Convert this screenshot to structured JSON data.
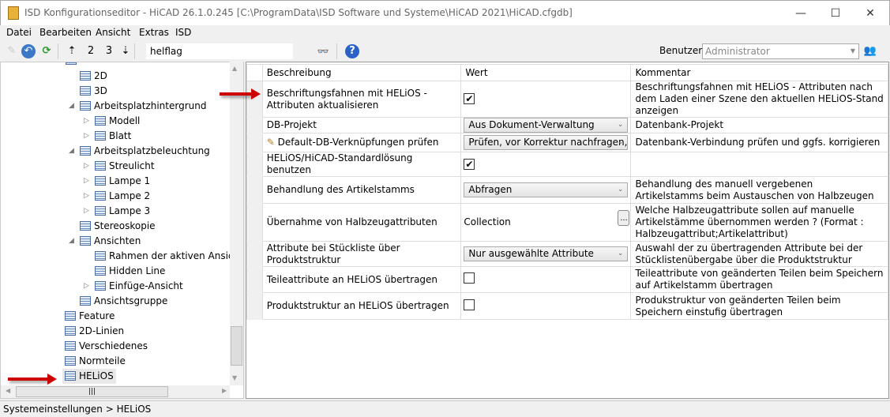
{
  "window": {
    "title": "ISD Konfigurationseditor  - HiCAD 26.1.0.245 [C:\\ProgramData\\ISD Software und Systeme\\HiCAD 2021\\HiCAD.cfgdb]",
    "minimize": "—",
    "maximize": "☐",
    "close": "✕"
  },
  "menu": [
    "Datei",
    "Bearbeiten",
    "Ansicht",
    "Extras",
    "ISD"
  ],
  "toolbar": {
    "search_value": "helflag",
    "user_label": "Benutzer",
    "user_value": "Administrator",
    "level2": "2",
    "level3": "3"
  },
  "tree": [
    {
      "label": "2D"
    },
    {
      "label": "3D"
    },
    {
      "label": "Arbeitsplatzhintergrund"
    },
    {
      "label": "Modell"
    },
    {
      "label": "Blatt"
    },
    {
      "label": "Arbeitsplatzbeleuchtung"
    },
    {
      "label": "Streulicht"
    },
    {
      "label": "Lampe 1"
    },
    {
      "label": "Lampe 2"
    },
    {
      "label": "Lampe 3"
    },
    {
      "label": "Stereoskopie"
    },
    {
      "label": "Ansichten"
    },
    {
      "label": "Rahmen der aktiven Ansicht"
    },
    {
      "label": "Hidden Line"
    },
    {
      "label": "Einfüge-Ansicht"
    },
    {
      "label": "Ansichtsgruppe"
    },
    {
      "label": "Feature"
    },
    {
      "label": "2D-Linien"
    },
    {
      "label": "Verschiedenes"
    },
    {
      "label": "Normteile"
    },
    {
      "label": "HELiOS",
      "selected": true
    }
  ],
  "grid": {
    "headers": [
      "Beschreibung",
      "Wert",
      "Kommentar"
    ],
    "rows": [
      {
        "desc": "Beschriftungsfahnen mit HELiOS - Attributen aktualisieren",
        "type": "checkbox",
        "checked": true,
        "comment": "Beschriftungsfahnen mit HELiOS - Attributen nach dem Laden einer Szene den aktuellen HELiOS-Stand anzeigen"
      },
      {
        "desc": "DB-Projekt",
        "type": "dropdown",
        "value": "Aus Dokument-Verwaltung",
        "comment": "Datenbank-Projekt"
      },
      {
        "desc": "Default-DB-Verknüpfungen prüfen",
        "type": "dropdown",
        "value": "Prüfen, vor Korrektur nachfragen,",
        "comment": "Datenbank-Verbindung prüfen und ggfs. korrigieren",
        "edited": true
      },
      {
        "desc": "HELiOS/HiCAD-Standardlösung benutzen",
        "type": "checkbox",
        "checked": true,
        "comment": ""
      },
      {
        "desc": "Behandlung des Artikelstamms",
        "type": "dropdown",
        "value": "Abfragen",
        "comment": "Behandlung des manuell vergebenen Artikelstamms beim Austauschen von Halbzeugen"
      },
      {
        "desc": "Übernahme von Halbzeugattributen",
        "type": "collection",
        "value": "Collection",
        "button": "...",
        "comment": "Welche Halbzeugattribute sollen auf manuelle Artikelstämme übernommen werden ? (Format : Halbzeugattribut;Artikelattribut)"
      },
      {
        "desc": "Attribute bei Stückliste über Produktstruktur",
        "type": "dropdown",
        "value": "Nur ausgewählte Attribute",
        "comment": "Auswahl der zu übertragenden Attribute bei der Stücklistenübergabe über die Produktstruktur"
      },
      {
        "desc": "Teileattribute an HELiOS übertragen",
        "type": "checkbox",
        "checked": false,
        "comment": "Teileattribute von geänderten Teilen beim Speichern auf Artikelstamm übertragen"
      },
      {
        "desc": "Produktstruktur an HELiOS übertragen",
        "type": "checkbox",
        "checked": false,
        "comment": "Produkstruktur von geänderten Teilen beim Speichern einstufig übertragen"
      }
    ]
  },
  "status": "Systemeinstellungen > HELiOS",
  "colors": {
    "arrow": "#cc0000",
    "selection": "#e8e8e8"
  }
}
